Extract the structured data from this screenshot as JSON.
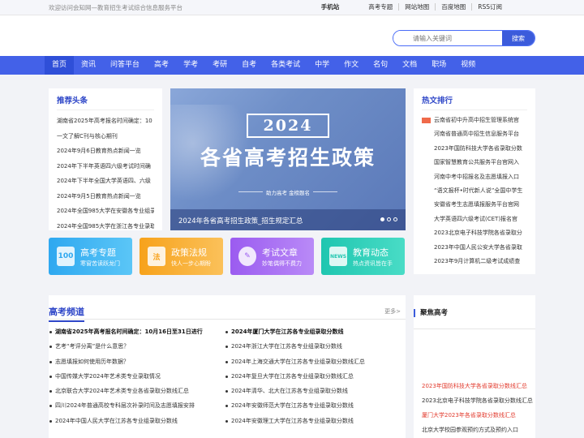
{
  "topbar": {
    "welcome": "欢迎访问会知网—教育招生考试综合信息服务平台",
    "links": [
      "手机站",
      "高考专题",
      "网站地图",
      "百度地图",
      "RSS订阅"
    ]
  },
  "search": {
    "placeholder": "请输入关键词",
    "button": "搜索"
  },
  "nav": [
    "首页",
    "资讯",
    "问答平台",
    "高考",
    "学考",
    "考研",
    "自考",
    "各类考试",
    "中学",
    "作文",
    "名句",
    "文档",
    "职场",
    "视频"
  ],
  "headlines": {
    "title": "推荐头条",
    "items": [
      "湖南省2025年高考报名时间确定：10",
      "一文了解C刊与核心期刊",
      "2024年9月6日教育热点新闻一览",
      "2024年下半年英语四六级考试时间确",
      "2024年下半年全国大学英语四、六级",
      "2024年9月5日教育热点新闻一览",
      "2024年全国985大学在安徽各专业组录",
      "2024年全国985大学在浙江各专业录取"
    ]
  },
  "banner": {
    "year": "2024",
    "title": "各省高考招生政策",
    "subtitle": "助力高考 金榜题名",
    "caption": "2024年各省高考招生政策_招生规定汇总"
  },
  "hot": {
    "title": "热文排行",
    "items": [
      "云南省初中升高中招生管理系统官",
      "河南省普通高中招生信息服务平台",
      "2023年国防科技大学各省录取分数",
      "国家智慧教育公共服务平台官网入",
      "河南中考中招报名及志愿填报入口",
      "“语文报杯•时代新人说”全国中学生",
      "安徽省考生志愿填报服务平台官网",
      "大学英语四六级考试(CET)报名官",
      "2023北京电子科技学院各省录取分",
      "2023年中国人民公安大学各省录取",
      "2023年9月计算机二级考试成绩查"
    ]
  },
  "tiles": [
    {
      "icon": "100",
      "title": "高考专题",
      "sub": "寒窗苦读跃龙门"
    },
    {
      "icon": "法",
      "title": "政策法规",
      "sub": "快人一步心期盼"
    },
    {
      "icon": "✎",
      "title": "考试文章",
      "sub": "妙笔偶得不费力"
    },
    {
      "icon": "NEWS",
      "title": "教育动态",
      "sub": "热点资讯皆在手"
    }
  ],
  "gaokao": {
    "title": "高考频道",
    "more": "更多>",
    "col1": [
      "湖南省2025年高考报名时间确定：10月16日至31日进行",
      "艺考“考评分离”是什么意思？",
      "志愿填报如何使用历年数据？",
      "中国传媒大学2024年艺术类专业录取情况",
      "北京联合大学2024年艺术类专业各省录取分数线汇总",
      "四川2024年普通高校专科层次补录时间及志愿填报安排",
      "2024年中国人民大学在江苏各专业组录取分数线"
    ],
    "col2": [
      "2024年厦门大学在江苏各专业组录取分数线",
      "2024年浙江大学在江苏各专业组录取分数线",
      "2024年上海交通大学在江苏各专业组录取分数线汇总",
      "2024年复旦大学在江苏各专业组录取分数线汇总",
      "2024年清华、北大在江苏各专业组录取分数线",
      "2024年安徽师范大学在江苏各专业组录取分数线",
      "2024年安徽理工大学在江苏各专业组录取分数线"
    ]
  },
  "focus": {
    "title": "聚焦高考",
    "items": [
      "2023年国防科技大学各省录取分数线汇总",
      "2023北京电子科技学院各省录取分数线汇总",
      "厦门大学2023年各省录取分数线汇总",
      "北京大学校园参观预约方式及预约入口"
    ]
  }
}
